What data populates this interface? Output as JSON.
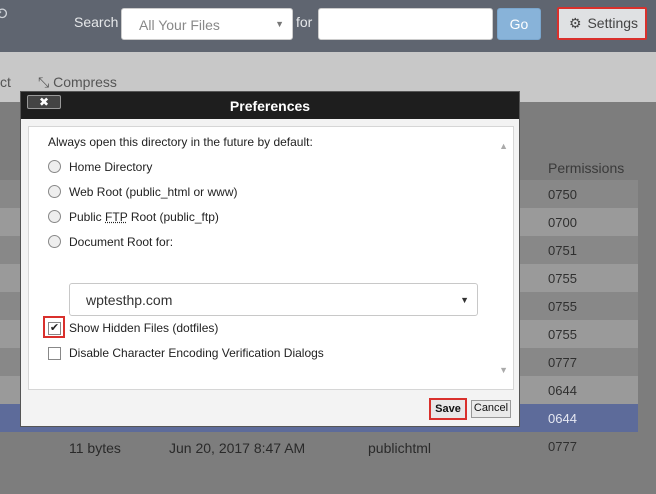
{
  "header": {
    "search_label": "Search",
    "search_scope": "All Your Files",
    "for_label": "for",
    "search_query": "",
    "go_label": "Go",
    "settings_label": "Settings"
  },
  "toolbar": {
    "partial_label": "ct",
    "compress_label": "Compress"
  },
  "file_table": {
    "permissions_header": "Permissions",
    "permissions": [
      "0750",
      "0700",
      "0751",
      "0755",
      "0755",
      "0755",
      "0777",
      "0644",
      "0644",
      "0777"
    ],
    "last_row": {
      "size": "11 bytes",
      "modified": "Jun 20, 2017 8:47 AM",
      "type": "publichtml"
    }
  },
  "dialog": {
    "title": "Preferences",
    "close_label": "✖",
    "heading": "Always open this directory in the future by default:",
    "options": [
      {
        "label": "Home Directory"
      },
      {
        "label": "Web Root (public_html or www)"
      },
      {
        "label_pre": "Public ",
        "abbr": "FTP",
        "label_post": " Root (public_ftp)"
      },
      {
        "label": "Document Root for:"
      }
    ],
    "domain_selected": "wptesthp.com",
    "show_hidden_label": "Show Hidden Files (dotfiles)",
    "show_hidden_checked": true,
    "disable_encoding_label": "Disable Character Encoding Verification Dialogs",
    "disable_encoding_checked": false,
    "save_label": "Save",
    "cancel_label": "Cancel"
  },
  "colors": {
    "highlight": "#d9302c",
    "selected_row": "#5d6b9a"
  }
}
